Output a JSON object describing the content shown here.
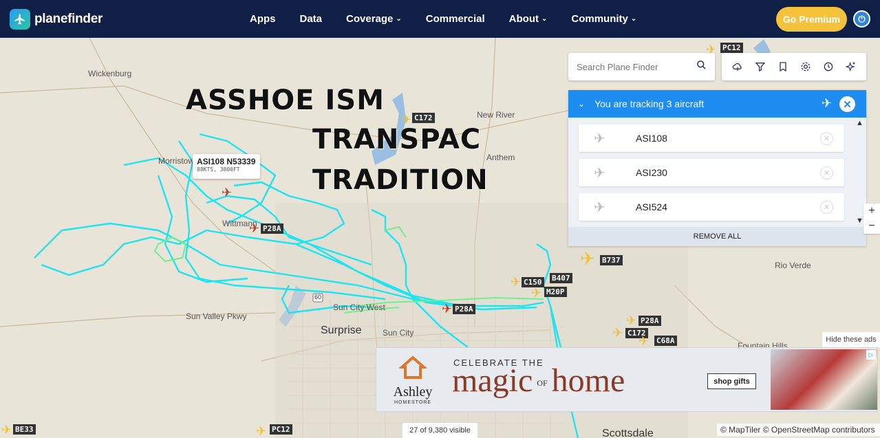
{
  "brand": {
    "name": "planefinder"
  },
  "nav": {
    "items": [
      {
        "label": "Apps",
        "has_dropdown": false
      },
      {
        "label": "Data",
        "has_dropdown": false
      },
      {
        "label": "Coverage",
        "has_dropdown": true
      },
      {
        "label": "Commercial",
        "has_dropdown": false
      },
      {
        "label": "About",
        "has_dropdown": true
      },
      {
        "label": "Community",
        "has_dropdown": true
      }
    ],
    "premium_label": "Go Premium"
  },
  "map_overlay": {
    "line1": "ASSHOE ISM",
    "line2": "TRANSPAC",
    "line3": "TRADITION"
  },
  "cities": {
    "wickenburg": "Wickenburg",
    "morristown": "Morristown",
    "wittmann": "Wittmann",
    "new_river": "New River",
    "anthem": "Anthem",
    "sun_city_west": "Sun City West",
    "sun_city": "Sun City",
    "surprise": "Surprise",
    "sun_valley_pkwy": "Sun Valley Pkwy",
    "rio_verde": "Rio Verde",
    "fountain_hills": "Fountain Hills",
    "scottsdale": "Scottsdale",
    "route": "60"
  },
  "aircraft_tags": {
    "pc12_top": "PC12",
    "c172_top": "C172",
    "p28a_1": "P28A",
    "b737": "B737",
    "b407": "B407",
    "c150": "C150",
    "m20p": "M20P",
    "p28a_2": "P28A",
    "p28a_3": "P28A",
    "c172_2": "C172",
    "c68a": "C68A",
    "be33": "BE33",
    "pc12_bottom": "PC12"
  },
  "tooltip": {
    "title": "ASI108 N53339",
    "sub": "88KTS, 3800FT"
  },
  "search": {
    "placeholder": "Search Plane Finder"
  },
  "tools": [
    "cloud-icon",
    "filter-icon",
    "bookmark-icon",
    "settings-icon",
    "history-icon",
    "sparkle-icon"
  ],
  "tracking": {
    "header": "You are tracking 3 aircraft",
    "rows": [
      {
        "label": "ASI108"
      },
      {
        "label": "ASI230"
      },
      {
        "label": "ASI524"
      }
    ],
    "remove_all": "REMOVE ALL"
  },
  "ad": {
    "hide_label": "Hide these ads",
    "brand": "Ashley",
    "brand_sub": "HOMESTORE",
    "top": "CELEBRATE THE",
    "main_a": "magic",
    "main_of": "OF",
    "main_b": "home",
    "button": "shop gifts"
  },
  "footer": {
    "visible": "27 of 9,380 visible",
    "attribution": "© MapTiler © OpenStreetMap contributors"
  },
  "colors": {
    "nav_bg": "#0f1f45",
    "premium": "#f5c33b",
    "track_head": "#1e8cf0",
    "track_line": "#1ee3f0",
    "track_green": "#6ff08a"
  }
}
